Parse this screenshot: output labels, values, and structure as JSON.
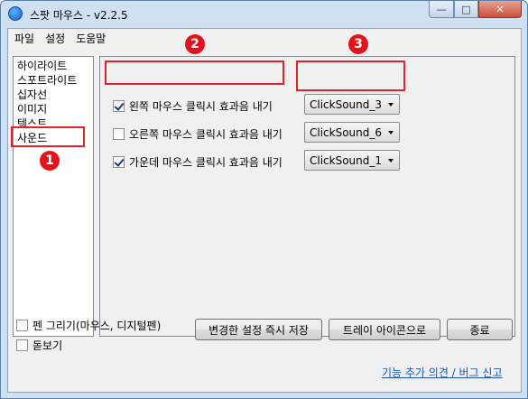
{
  "window": {
    "title": "스팟 마우스 - v2.2.5",
    "min_glyph": "—",
    "max_glyph": "□",
    "close_glyph": "✕"
  },
  "menu": [
    "파일",
    "설정",
    "도움말"
  ],
  "sidebar": {
    "items": [
      "하이라이트",
      "스포트라이트",
      "십자선",
      "이미지",
      "텍스트",
      "사운드"
    ],
    "selected_index": 5
  },
  "sound": {
    "rows": [
      {
        "label": "왼쪽 마우스 클릭시 효과음 내기",
        "checked": true,
        "sound": "ClickSound_3"
      },
      {
        "label": "오른쪽 마우스 클릭시 효과음 내기",
        "checked": false,
        "sound": "ClickSound_6"
      },
      {
        "label": "가운데 마우스 클릭시 효과음 내기",
        "checked": true,
        "sound": "ClickSound_1"
      }
    ]
  },
  "options": {
    "pen_label": "펜 그리기(마우스, 디지털펜)",
    "pen_checked": false,
    "magnifier_label": "돋보기",
    "magnifier_checked": false
  },
  "buttons": {
    "apply": "변경한 설정 즉시 저장",
    "tray": "트레이 아이콘으로",
    "exit": "종료"
  },
  "feedback_link": "기능 추가 의견 / 버그 신고",
  "annotations": {
    "badge1": "1",
    "badge2": "2",
    "badge3": "3",
    "accent": "#e3121b"
  }
}
